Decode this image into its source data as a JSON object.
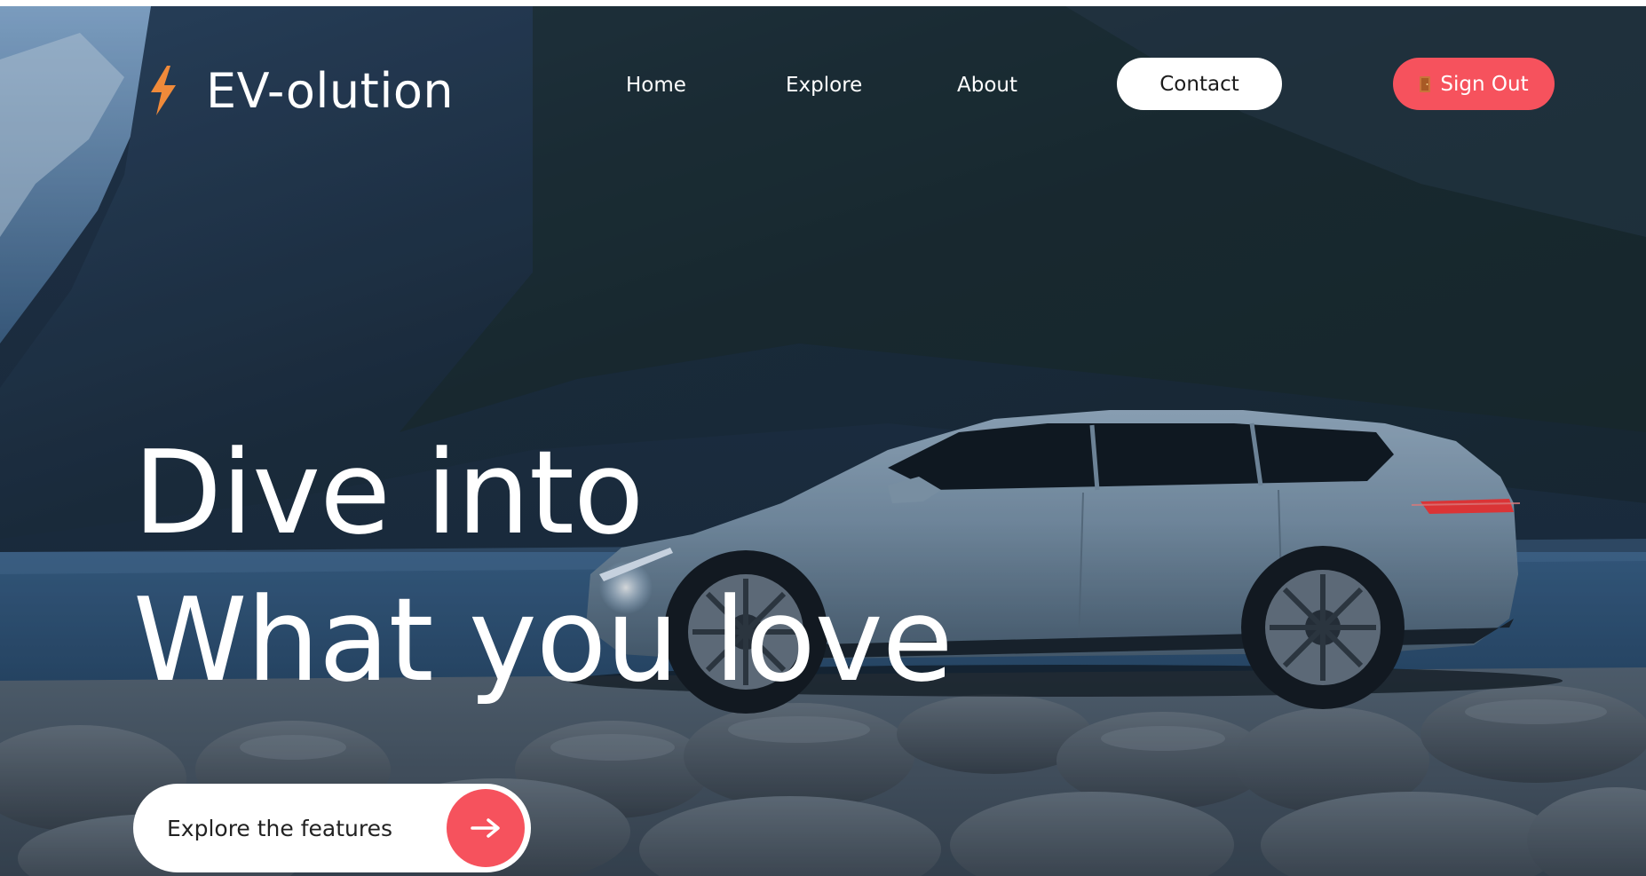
{
  "brand": {
    "name": "EV-olution",
    "icon": "lightning-bolt-icon",
    "icon_color": "#f08a3a"
  },
  "nav": {
    "home": "Home",
    "explore": "Explore",
    "about": "About",
    "contact": "Contact",
    "sign_out": "Sign Out",
    "sign_out_icon": "door-icon"
  },
  "hero": {
    "headline_line1": "Dive into",
    "headline_line2": "What you love",
    "cta_label": "Explore the features",
    "cta_icon": "arrow-right-icon"
  },
  "colors": {
    "accent": "#f6525d",
    "text_on_dark": "#ffffff",
    "button_light": "#ffffff"
  }
}
